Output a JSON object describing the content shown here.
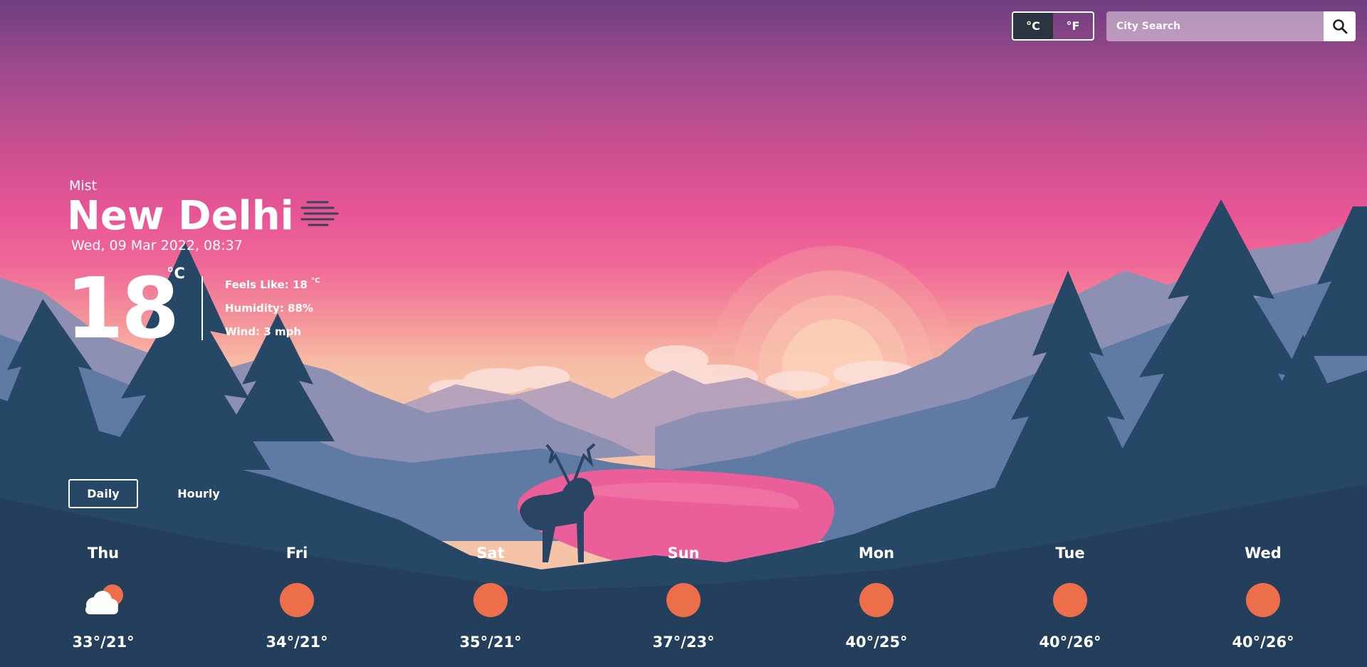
{
  "units": {
    "celsius_label": "°C",
    "fahrenheit_label": "°F",
    "active": "celsius"
  },
  "search": {
    "placeholder": "City Search"
  },
  "current": {
    "condition": "Mist",
    "city": "New Delhi",
    "datetime": "Wed, 09 Mar 2022, 08:37",
    "temp": "18",
    "temp_unit": "°C",
    "feels_like_label": "Feels Like: 18",
    "feels_like_unit": "°C",
    "humidity": "Humidity: 88%",
    "wind": "Wind: 3 mph",
    "icon": "mist-icon"
  },
  "tabs": {
    "daily": "Daily",
    "hourly": "Hourly",
    "active": "daily"
  },
  "forecast": [
    {
      "day": "Thu",
      "temps": "33°/21°",
      "icon": "partly-cloudy-icon"
    },
    {
      "day": "Fri",
      "temps": "34°/21°",
      "icon": "sun-icon"
    },
    {
      "day": "Sat",
      "temps": "35°/21°",
      "icon": "sun-icon"
    },
    {
      "day": "Sun",
      "temps": "37°/23°",
      "icon": "sun-icon"
    },
    {
      "day": "Mon",
      "temps": "40°/25°",
      "icon": "sun-icon"
    },
    {
      "day": "Tue",
      "temps": "40°/26°",
      "icon": "sun-icon"
    },
    {
      "day": "Wed",
      "temps": "40°/26°",
      "icon": "sun-icon"
    }
  ],
  "colors": {
    "sky_top": "#6e3e7e",
    "sky_mid": "#e85596",
    "horizon": "#f5c4a8",
    "forest": "#233f5c",
    "sun_icon": "#ec6e4b",
    "active_toggle": "#2a3540"
  }
}
